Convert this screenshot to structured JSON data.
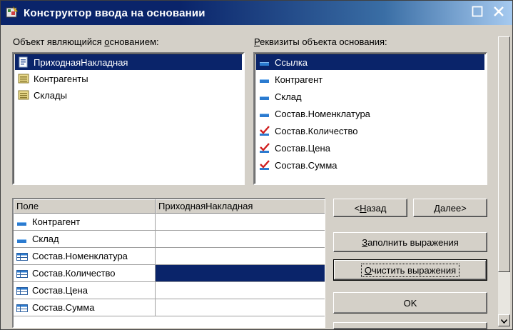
{
  "window": {
    "title": "Конструктор ввода на основании"
  },
  "left_panel": {
    "label_pre": "Объект являющийся ",
    "label_ul": "о",
    "label_post": "снованием:",
    "items": [
      {
        "label": "ПриходнаяНакладная",
        "icon": "document-icon",
        "selected": true
      },
      {
        "label": "Контрагенты",
        "icon": "catalog-icon",
        "selected": false
      },
      {
        "label": "Склады",
        "icon": "catalog-icon",
        "selected": false
      }
    ]
  },
  "right_panel": {
    "label_ul": "Р",
    "label_post": "еквизиты объекта основания:",
    "items": [
      {
        "label": "Ссылка",
        "icon": "attribute-icon",
        "selected": true
      },
      {
        "label": "Контрагент",
        "icon": "attribute-icon",
        "selected": false
      },
      {
        "label": "Склад",
        "icon": "attribute-icon",
        "selected": false
      },
      {
        "label": "Состав.Номенклатура",
        "icon": "attribute-icon",
        "selected": false
      },
      {
        "label": "Состав.Количество",
        "icon": "checkmark-icon",
        "selected": false
      },
      {
        "label": "Состав.Цена",
        "icon": "checkmark-icon",
        "selected": false
      },
      {
        "label": "Состав.Сумма",
        "icon": "checkmark-icon",
        "selected": false
      }
    ]
  },
  "grid": {
    "columns": [
      "Поле",
      "ПриходнаяНакладная"
    ],
    "rows": [
      {
        "field": "Контрагент",
        "icon": "attribute-icon",
        "value": "",
        "selected": false
      },
      {
        "field": "Склад",
        "icon": "attribute-icon",
        "value": "",
        "selected": false
      },
      {
        "field": "Состав.Номенклатура",
        "icon": "table-icon",
        "value": "",
        "selected": false
      },
      {
        "field": "Состав.Количество",
        "icon": "table-icon",
        "value": "",
        "selected": true
      },
      {
        "field": "Состав.Цена",
        "icon": "table-icon",
        "value": "",
        "selected": false
      },
      {
        "field": "Состав.Сумма",
        "icon": "table-icon",
        "value": "",
        "selected": false
      }
    ]
  },
  "buttons": {
    "back": {
      "pre": "<",
      "ul": "Н",
      "post": "азад"
    },
    "next": {
      "pre": "",
      "ul": "Д",
      "post": "алее>"
    },
    "fill": {
      "pre": "",
      "ul": "З",
      "post": "аполнить выражения"
    },
    "clear": {
      "pre": "",
      "ul": "О",
      "post": "чистить выражения"
    },
    "ok": {
      "label": "OK"
    }
  },
  "colors": {
    "selection": "#0a246a",
    "titlebar_start": "#0a246a",
    "titlebar_end": "#a6caf0",
    "face": "#d4d0c8"
  }
}
